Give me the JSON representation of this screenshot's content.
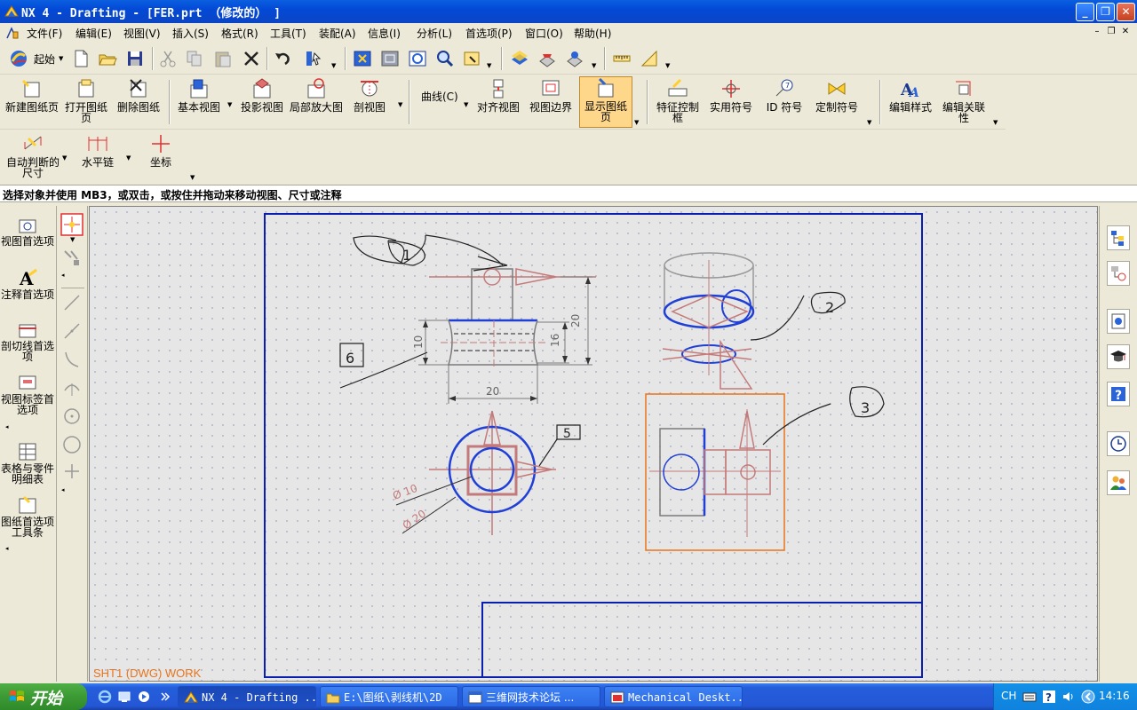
{
  "window": {
    "title": "NX 4 - Drafting - [FER.prt （修改的） ]",
    "controls": {
      "minimize": "_",
      "maximize": "❐",
      "close": "✕"
    }
  },
  "menubar": {
    "items": [
      "文件(F)",
      "编辑(E)",
      "视图(V)",
      "插入(S)",
      "格式(R)",
      "工具(T)",
      "装配(A)",
      "信息(I)",
      "分析(L)",
      "首选项(P)",
      "窗口(O)",
      "帮助(H)"
    ],
    "doc_controls": {
      "minimize": "–",
      "restore": "❐",
      "close": "✕"
    }
  },
  "standard_toolbar": {
    "start_label": "起始"
  },
  "drawing_toolbar": {
    "buttons": [
      "新建图纸页",
      "打开图纸页",
      "删除图纸",
      "基本视图",
      "投影视图",
      "局部放大图",
      "剖视图",
      "曲线(C)",
      "对齐视图",
      "视图边界",
      "显示图纸页",
      "特征控制框",
      "实用符号",
      "ID 符号",
      "定制符号",
      "编辑样式",
      "编辑关联性"
    ],
    "active": "显示图纸页"
  },
  "dimension_toolbar": {
    "buttons": [
      "自动判断的尺寸",
      "水平链",
      "坐标"
    ]
  },
  "cue_line": "选择对象并使用 MB3，或双击，或按住并拖动来移动视图、尺寸或注释",
  "left_palette": {
    "items": [
      "视图首选项",
      "注释首选项",
      "剖切线首选项",
      "视图标签首选项",
      "表格与零件明细表",
      "图纸首选项工具条"
    ]
  },
  "canvas": {
    "sheet_label": "SHT1 (DWG) WORK",
    "dimensions": [
      "20",
      "20",
      "10",
      "16",
      "Ø 10",
      "Ø 20"
    ],
    "balloons": [
      "1",
      "2",
      "3",
      "6",
      "5"
    ]
  },
  "taskbar": {
    "start": "开始",
    "tasks": [
      "NX 4 - Drafting ...",
      "E:\\图纸\\剥线机\\2D",
      "三维网技术论坛 ...",
      "Mechanical Deskt..."
    ],
    "active_task": "NX 4 - Drafting ...",
    "tray": {
      "language": "CH",
      "clock": "14:16"
    }
  },
  "colors": {
    "titlebar": "#0a5fe0",
    "drawing_border": "#0a1fb0",
    "view_pink": "#c47a7a",
    "view_blue": "#1f3fd6",
    "view_border_orange": "#e8741c",
    "sheet_label": "#e8741c"
  }
}
